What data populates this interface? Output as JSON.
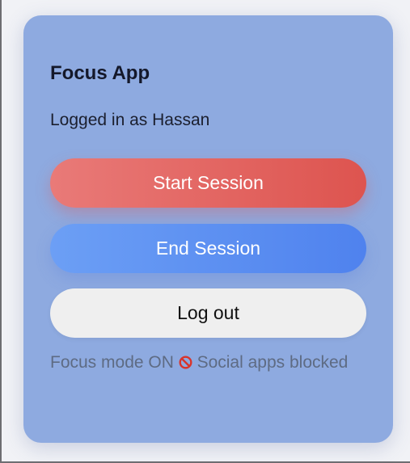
{
  "app": {
    "title": "Focus App",
    "user_text": "Logged in as Hassan"
  },
  "actions": {
    "start_label": "Start Session",
    "end_label": "End Session",
    "logout_label": "Log out"
  },
  "status": {
    "text_before": "Focus mode ON",
    "icon": "prohibited-icon",
    "text_after": "Social apps blocked"
  },
  "colors": {
    "card_bg": "#8eaae0",
    "start_button": "#e2605c",
    "end_button": "#5b8ff2",
    "logout_button": "#efefef",
    "status_text": "#5e6b83"
  }
}
